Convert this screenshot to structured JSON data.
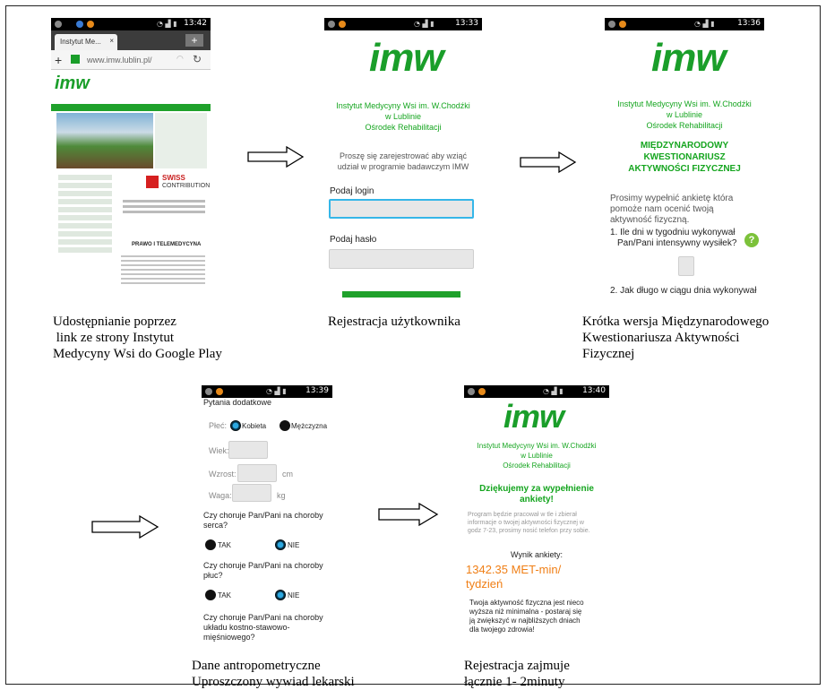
{
  "panel1": {
    "status_time": "13:42",
    "tab_title": "Instytut Me...",
    "url": "www.imw.lublin.pl/",
    "swiss_title": "SWISS",
    "swiss_sub": "CONTRIBUTION",
    "section_heading": "PRAWO I TELEMEDYCYNA",
    "caption": [
      "Udostępnianie poprzez",
      " link ze strony Instytut",
      "Medycyny Wsi do Google Play"
    ]
  },
  "panel2": {
    "status_time": "13:33",
    "logo_text": "imw",
    "institute": [
      "Instytut Medycyny Wsi im. W.Chodźki",
      "w Lublinie",
      "Ośrodek Rehabilitacji"
    ],
    "prompt": [
      "Proszę się zarejestrować aby wziąć",
      "udział w programie badawczym IMW"
    ],
    "login_label": "Podaj login",
    "password_label": "Podaj hasło",
    "caption": "Rejestracja użytkownika"
  },
  "panel3": {
    "status_time": "13:36",
    "logo_text": "imw",
    "institute": [
      "Instytut Medycyny Wsi im. W.Chodźki",
      "w Lublinie",
      "Ośrodek Rehabilitacji"
    ],
    "heading": [
      "MIĘDZYNARODOWY",
      "KWESTIONARIUSZ",
      "AKTYWNOŚCI FIZYCZNEJ"
    ],
    "intro": [
      "Prosimy wypełnić ankietę która",
      "pomoże nam ocenić twoją",
      "aktywność fizyczną."
    ],
    "q1": [
      "1. Ile dni w tygodniu wykonywał",
      "Pan/Pani intensywny wysiłek?"
    ],
    "help": "?",
    "q2": "2. Jak długo w ciągu dnia wykonywał",
    "caption": [
      "Krótka wersja Międzynarodowego",
      "Kwestionariusza Aktywności",
      "Fizycznej"
    ]
  },
  "panel4": {
    "status_time": "13:39",
    "title": "Pytania dodatkowe",
    "sex_label": "Płeć:",
    "female": "Kobieta",
    "male": "Mężczyzna",
    "age_label": "Wiek:",
    "height_label": "Wzrost:",
    "height_unit": "cm",
    "weight_label": "Waga:",
    "weight_unit": "kg",
    "q_heart": [
      "Czy choruje Pan/Pani na choroby",
      "serca?"
    ],
    "q_lungs": [
      "Czy choruje Pan/Pani na choroby",
      "płuc?"
    ],
    "q_bones": [
      "Czy choruje Pan/Pani na choroby",
      "układu kostno-stawowo-",
      "mięśniowego?"
    ],
    "yes": "TAK",
    "no": "NIE",
    "caption": [
      "Dane antropometryczne",
      "Uproszczony wywiad lekarski"
    ]
  },
  "panel5": {
    "status_time": "13:40",
    "logo_text": "imw",
    "institute": [
      "Instytut Medycyny Wsi im. W.Chodźki",
      "w Lublinie",
      "Ośrodek Rehabilitacji"
    ],
    "thanks": [
      "Dziękujemy za wypełnienie",
      "ankiety!"
    ],
    "info": [
      "Program będzie pracował w tle i zbierał",
      "informacje o twojej aktywności fizycznej w",
      "godz 7-23, prosimy nosić telefon przy sobie."
    ],
    "result_label": "Wynik ankiety:",
    "result_value": [
      "1342.35 MET-min/",
      "tydzień"
    ],
    "result_text": [
      "Twoja aktywność fizyczna jest nieco",
      "wyższa niż minimalna - postaraj się",
      "ją zwiększyć w najbliższych dniach",
      "dla twojego zdrowia!"
    ],
    "caption": [
      "Rejestracja zajmuje",
      "łącznie 1- 2minuty"
    ]
  },
  "colors": {
    "brand_green": "#15a51f",
    "result_orange": "#f07f16"
  }
}
